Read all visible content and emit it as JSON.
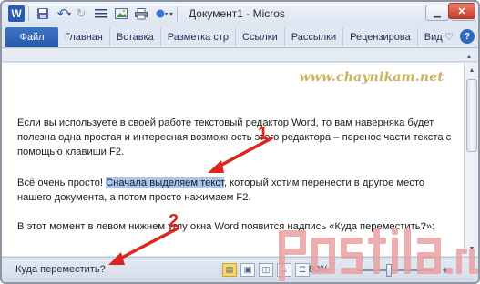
{
  "window": {
    "title": "Документ1 - Micros",
    "logo_letter": "W",
    "buttons": [
      "minimize-icon",
      "restore-icon",
      "close-icon"
    ]
  },
  "quick_access": [
    "save-icon",
    "undo-icon",
    "redo-icon",
    "format-icon",
    "insert-picture-icon",
    "print-preview-icon",
    "customize-icon"
  ],
  "ribbon": {
    "file_tab": "Файл",
    "tabs": [
      "Главная",
      "Вставка",
      "Разметка стр",
      "Ссылки",
      "Рассылки",
      "Рецензирова",
      "Вид"
    ],
    "tools": [
      "ribbon-collapse-icon",
      "help-icon"
    ]
  },
  "watermark": "www.chaynikam.net",
  "document": {
    "p1": "Если вы используете в своей работе текстовый редактор Word, то вам наверняка будет полезна одна простая и интересная возможность этого редактора – перенос части текста с помощью клавиши F2.",
    "p2_before": "Всё очень просто! ",
    "p2_highlight": "Сначала выделяем текст",
    "p2_after": ", который хотим перенести в другое место нашего документа, а потом просто нажимаем F2.",
    "p3": "В этот момент в левом нижнем углу окна Word появится надпись «Куда переместить?»:"
  },
  "annotations": {
    "label1": "1",
    "label2": "2",
    "accent_color": "#e0241b"
  },
  "status_bar": {
    "text": "Куда переместить?",
    "zoom": "80%",
    "zoom_minus": "−",
    "zoom_plus": "+"
  },
  "brand": {
    "logo_text": "postila.ru",
    "logo_color": "#e9a1a1"
  }
}
